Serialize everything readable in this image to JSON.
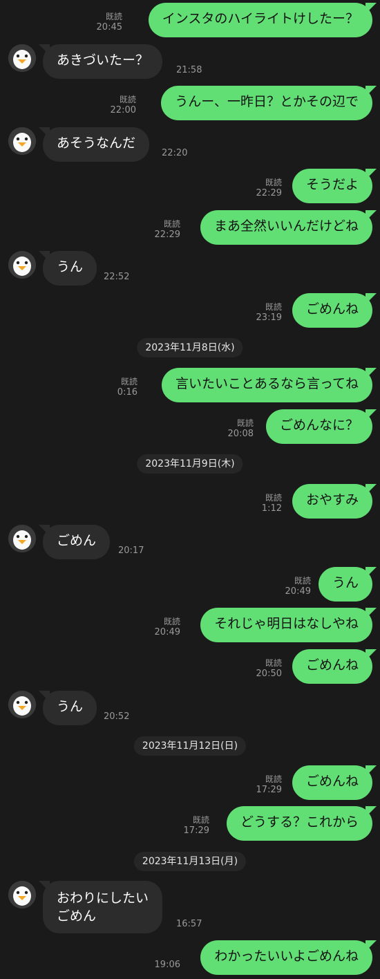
{
  "read_label": "既読",
  "messages": [
    {
      "dir": "out",
      "text": "インスタのハイライトけしたー？",
      "time": "20:45",
      "read": true
    },
    {
      "dir": "in",
      "text": "あきづいたー？",
      "time": "21:58"
    },
    {
      "dir": "out",
      "text": "うんー、一昨日？とかその辺で",
      "time": "22:00",
      "read": true
    },
    {
      "dir": "in",
      "text": "あそうなんだ",
      "time": "22:20"
    },
    {
      "dir": "out",
      "text": "そうだよ",
      "time": "22:29",
      "read": true
    },
    {
      "dir": "out",
      "text": "まあ全然いいんだけどね",
      "time": "22:29",
      "read": true
    },
    {
      "dir": "in",
      "text": "うん",
      "time": "22:52"
    },
    {
      "dir": "out",
      "text": "ごめんね",
      "time": "23:19",
      "read": true
    },
    {
      "dir": "date",
      "text": "2023年11月8日(水)"
    },
    {
      "dir": "out",
      "text": "言いたいことあるなら言ってね",
      "time": "0:16",
      "read": true
    },
    {
      "dir": "out",
      "text": "ごめんなに？",
      "time": "20:08",
      "read": true
    },
    {
      "dir": "date",
      "text": "2023年11月9日(木)"
    },
    {
      "dir": "out",
      "text": "おやすみ",
      "time": "1:12",
      "read": true
    },
    {
      "dir": "in",
      "text": "ごめん",
      "time": "20:17"
    },
    {
      "dir": "out",
      "text": "うん",
      "time": "20:49",
      "read": true
    },
    {
      "dir": "out",
      "text": "それじゃ明日はなしやね",
      "time": "20:49",
      "read": true
    },
    {
      "dir": "out",
      "text": "ごめんね",
      "time": "20:50",
      "read": true
    },
    {
      "dir": "in",
      "text": "うん",
      "time": "20:52"
    },
    {
      "dir": "date",
      "text": "2023年11月12日(日)"
    },
    {
      "dir": "out",
      "text": "ごめんね",
      "time": "17:29",
      "read": true
    },
    {
      "dir": "out",
      "text": "どうする？これから",
      "time": "17:29",
      "read": true
    },
    {
      "dir": "date",
      "text": "2023年11月13日(月)"
    },
    {
      "dir": "in",
      "text": "おわりにしたい\nごめん",
      "time": "16:57",
      "multiline": true
    },
    {
      "dir": "out",
      "text": "わかったいいよごめんね",
      "time": "19:06",
      "read": false
    }
  ]
}
